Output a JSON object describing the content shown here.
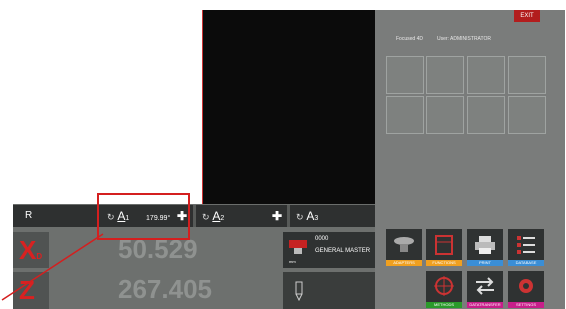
{
  "header": {
    "exit_label": "EXIT"
  },
  "status": {
    "left": "Focused 4D",
    "right": "User: ADMINISTRATOR"
  },
  "axis_bar": {
    "r_label": "R",
    "a1": {
      "letter": "A",
      "index": "1",
      "value": "179.99°"
    },
    "a2": {
      "letter": "A",
      "index": "2"
    },
    "a3": {
      "letter": "A",
      "index": "3"
    }
  },
  "readouts": {
    "x": {
      "axis": "X",
      "sub": "D",
      "value": "50.529"
    },
    "z": {
      "axis": "Z",
      "value": "267.405"
    }
  },
  "master": {
    "code": "0000",
    "name": "GENERAL MASTER",
    "unit": "mm"
  },
  "tools": {
    "row1": [
      {
        "label": "ADAPTERS",
        "color": "#f0a020",
        "icon": "adapter-icon"
      },
      {
        "label": "FUNCTIONS",
        "color": "#f0a020",
        "icon": "functions-icon"
      },
      {
        "label": "PRINT",
        "color": "#3a8ed6",
        "icon": "printer-icon"
      },
      {
        "label": "DATABASE",
        "color": "#3a8ed6",
        "icon": "database-icon"
      }
    ],
    "row2": [
      {
        "label": "METHODS",
        "color": "#2a9a2a",
        "icon": "target-icon"
      },
      {
        "label": "DATATRANSFER",
        "color": "#c81e8a",
        "icon": "transfer-icon"
      },
      {
        "label": "SETTINGS",
        "color": "#c81e8a",
        "icon": "settings-icon"
      }
    ]
  }
}
